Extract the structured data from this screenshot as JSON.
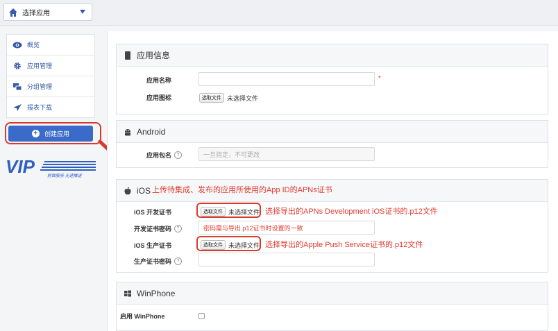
{
  "topbar": {
    "app_select_label": "选择应用"
  },
  "sidebar": {
    "items": [
      {
        "label": "概览",
        "icon": "eye-icon"
      },
      {
        "label": "应用管理",
        "icon": "gear-icon"
      },
      {
        "label": "分组管理",
        "icon": "group-icon"
      },
      {
        "label": "报表下载",
        "icon": "send-icon"
      }
    ],
    "create_button_label": "创建应用"
  },
  "logo": {
    "main": "VIP",
    "subtitle": "前致服务 光速推送"
  },
  "app_info": {
    "title": "应用信息",
    "name_label": "应用名称",
    "name_value": "",
    "icon_label": "应用图标",
    "file_button": "选取文件",
    "no_file": "未选择文件"
  },
  "android": {
    "title": "Android",
    "package_label": "应用包名",
    "package_placeholder": "一旦指定，不可更改"
  },
  "ios": {
    "title": "iOS",
    "title_annotation": "上传待集成、发布的应用所使用的App ID的APNs证书",
    "dev_cert_label": "iOS 开发证书",
    "dev_pwd_label": "开发证书密码",
    "prod_cert_label": "iOS 生产证书",
    "prod_pwd_label": "生产证书密码",
    "file_button": "选取文件",
    "no_file": "未选择文件",
    "dev_annotation": "选择导出的APNs Development iOS证书的.p12文件",
    "pwd_annotation": "密码需与导出.p12证书时设置的一致",
    "prod_annotation": "选择导出的Apple Push Service证书的.p12文件"
  },
  "winphone": {
    "title": "WinPhone",
    "enable_label": "启用 WinPhone"
  },
  "colors": {
    "accent": "#3a6bc9",
    "annotation_red": "#e2392f",
    "link_blue": "#355ba8"
  }
}
